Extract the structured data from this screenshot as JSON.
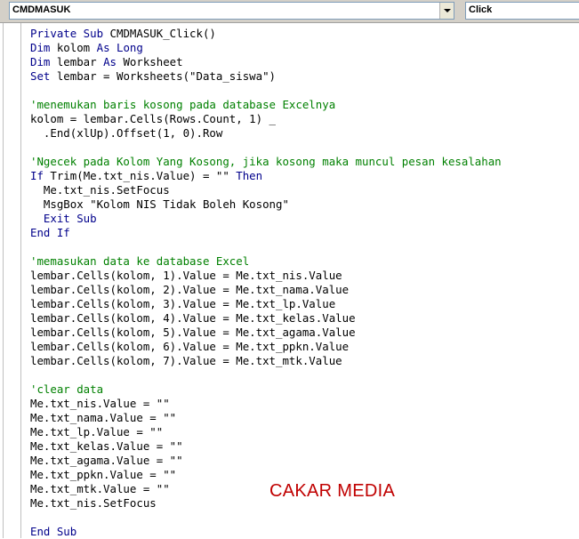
{
  "toolbar": {
    "object_dropdown": "CMDMASUK",
    "procedure_dropdown": "Click"
  },
  "code_lines": [
    [
      {
        "t": "Private Sub ",
        "c": "kw"
      },
      {
        "t": "CMDMASUK_Click()",
        "c": ""
      }
    ],
    [
      {
        "t": "Dim ",
        "c": "kw"
      },
      {
        "t": "kolom ",
        "c": ""
      },
      {
        "t": "As Long",
        "c": "kw"
      }
    ],
    [
      {
        "t": "Dim ",
        "c": "kw"
      },
      {
        "t": "lembar ",
        "c": ""
      },
      {
        "t": "As ",
        "c": "kw"
      },
      {
        "t": "Worksheet",
        "c": ""
      }
    ],
    [
      {
        "t": "Set ",
        "c": "kw"
      },
      {
        "t": "lembar = Worksheets(\"Data_siswa\")",
        "c": ""
      }
    ],
    [],
    [
      {
        "t": "'menemukan baris kosong pada database Excelnya",
        "c": "cm"
      }
    ],
    [
      {
        "t": "kolom = lembar.Cells(Rows.Count, 1) _",
        "c": ""
      }
    ],
    [
      {
        "t": "  .End(xlUp).Offset(1, 0).Row",
        "c": ""
      }
    ],
    [],
    [
      {
        "t": "'Ngecek pada Kolom Yang Kosong, jika kosong maka muncul pesan kesalahan",
        "c": "cm"
      }
    ],
    [
      {
        "t": "If ",
        "c": "kw"
      },
      {
        "t": "Trim(Me.txt_nis.Value) = \"\" ",
        "c": ""
      },
      {
        "t": "Then",
        "c": "kw"
      }
    ],
    [
      {
        "t": "  Me.txt_nis.SetFocus",
        "c": ""
      }
    ],
    [
      {
        "t": "  MsgBox \"Kolom NIS Tidak Boleh Kosong\"",
        "c": ""
      }
    ],
    [
      {
        "t": "  Exit Sub",
        "c": "kw"
      }
    ],
    [
      {
        "t": "End If",
        "c": "kw"
      }
    ],
    [],
    [
      {
        "t": "'memasukan data ke database Excel",
        "c": "cm"
      }
    ],
    [
      {
        "t": "lembar.Cells(kolom, 1).Value = Me.txt_nis.Value",
        "c": ""
      }
    ],
    [
      {
        "t": "lembar.Cells(kolom, 2).Value = Me.txt_nama.Value",
        "c": ""
      }
    ],
    [
      {
        "t": "lembar.Cells(kolom, 3).Value = Me.txt_lp.Value",
        "c": ""
      }
    ],
    [
      {
        "t": "lembar.Cells(kolom, 4).Value = Me.txt_kelas.Value",
        "c": ""
      }
    ],
    [
      {
        "t": "lembar.Cells(kolom, 5).Value = Me.txt_agama.Value",
        "c": ""
      }
    ],
    [
      {
        "t": "lembar.Cells(kolom, 6).Value = Me.txt_ppkn.Value",
        "c": ""
      }
    ],
    [
      {
        "t": "lembar.Cells(kolom, 7).Value = Me.txt_mtk.Value",
        "c": ""
      }
    ],
    [],
    [
      {
        "t": "'clear data",
        "c": "cm"
      }
    ],
    [
      {
        "t": "Me.txt_nis.Value = \"\"",
        "c": ""
      }
    ],
    [
      {
        "t": "Me.txt_nama.Value = \"\"",
        "c": ""
      }
    ],
    [
      {
        "t": "Me.txt_lp.Value = \"\"",
        "c": ""
      }
    ],
    [
      {
        "t": "Me.txt_kelas.Value = \"\"",
        "c": ""
      }
    ],
    [
      {
        "t": "Me.txt_agama.Value = \"\"",
        "c": ""
      }
    ],
    [
      {
        "t": "Me.txt_ppkn.Value = \"\"",
        "c": ""
      }
    ],
    [
      {
        "t": "Me.txt_mtk.Value = \"\"",
        "c": ""
      }
    ],
    [
      {
        "t": "Me.txt_nis.SetFocus",
        "c": ""
      }
    ],
    [],
    [
      {
        "t": "End Sub",
        "c": "kw"
      }
    ]
  ],
  "watermark": "CAKAR MEDIA",
  "colors": {
    "keyword": "#00008b",
    "comment": "#008000",
    "watermark": "#c00000"
  }
}
